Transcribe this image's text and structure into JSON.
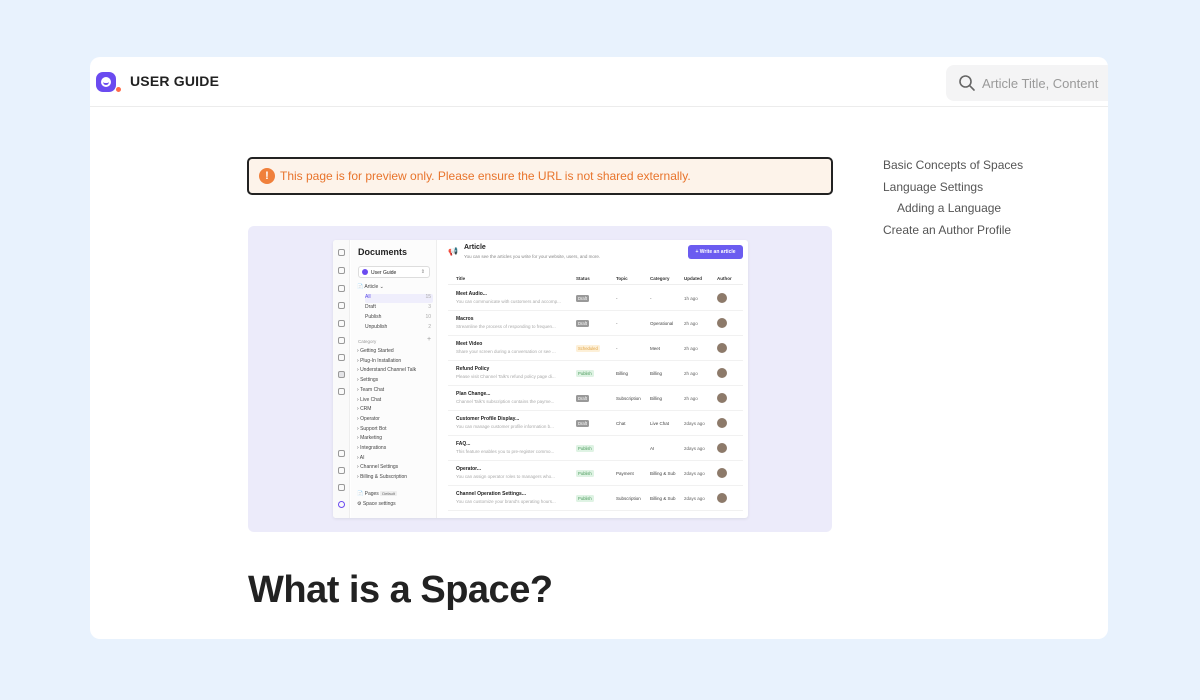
{
  "header": {
    "brand": "USER GUIDE",
    "search_placeholder": "Article Title, Content"
  },
  "notice": {
    "icon": "!",
    "text": "This page is for preview only. Please ensure the URL is not shared externally."
  },
  "toc": [
    {
      "label": "Basic Concepts of Spaces"
    },
    {
      "label": "Language Settings"
    },
    {
      "label": "Adding a Language"
    },
    {
      "label": "Create an Author Profile"
    }
  ],
  "heading": "What is a Space?",
  "preview": {
    "docs_title": "Documents",
    "space_name": "User Guide",
    "article_root": "Article",
    "status_items": [
      {
        "label": "All",
        "count": "15"
      },
      {
        "label": "Draft",
        "count": "3"
      },
      {
        "label": "Publish",
        "count": "10"
      },
      {
        "label": "Unpublish",
        "count": "2"
      }
    ],
    "category_label": "Category",
    "category_items": [
      "Getting Started",
      "Plug-In Installation",
      "Understand Channel Talk",
      "Settings",
      "Team Chat",
      "Live Chat",
      "CRM",
      "Operator",
      "Support Bot",
      "Marketing",
      "Integrations",
      "AI",
      "Channel Settings",
      "Billing & Subscription"
    ],
    "pages_label": "Pages",
    "pages_badge": "Default",
    "space_settings_label": "Space settings",
    "article_title": "Article",
    "article_sub": "You can see the articles you write for your website, users, and more.",
    "write_button": "+ Write an article",
    "columns": [
      "Title",
      "Status",
      "Topic",
      "Category",
      "Updated",
      "Author"
    ],
    "rows": [
      {
        "title": "Meet Audio...",
        "desc": "You can communicate with customers and accomp...",
        "status": "Draft",
        "status_type": "draft",
        "topic": "-",
        "category": "-",
        "updated": "1h ago"
      },
      {
        "title": "Macros",
        "desc": "Streamline the process of responding to frequen...",
        "status": "Draft",
        "status_type": "draft",
        "topic": "-",
        "category": "Operational",
        "updated": "2h ago"
      },
      {
        "title": "Meet Video",
        "desc": "Share your screen during a conversation or see ...",
        "status": "Scheduled",
        "status_type": "sched",
        "topic": "-",
        "category": "Meet",
        "updated": "2h ago"
      },
      {
        "title": "Refund Policy",
        "desc": "Please visit Channel Talk's refund policy page di...",
        "status": "Publish",
        "status_type": "pub",
        "topic": "Billing",
        "category": "Billing",
        "updated": "2h ago"
      },
      {
        "title": "Plan Change...",
        "desc": "Channel Talk's subscription contains the payme...",
        "status": "Draft",
        "status_type": "draft",
        "topic": "Subscription",
        "category": "Billing",
        "updated": "2h ago"
      },
      {
        "title": "Customer Profile Display...",
        "desc": "You can manage customer profile information b...",
        "status": "Draft",
        "status_type": "draft",
        "topic": "Chat",
        "category": "Live Chat",
        "updated": "2days ago"
      },
      {
        "title": "FAQ...",
        "desc": "This feature enables you to pre-register commo...",
        "status": "Publish",
        "status_type": "pub",
        "topic": "",
        "category": "AI",
        "updated": "2days ago"
      },
      {
        "title": "Operator...",
        "desc": "You can assign operator roles to managers who...",
        "status": "Publish",
        "status_type": "pub",
        "topic": "Payment",
        "category": "Billing & Sub",
        "updated": "2days ago"
      },
      {
        "title": "Channel Operation Settings...",
        "desc": "You can customize your brand's operating hours...",
        "status": "Publish",
        "status_type": "pub",
        "topic": "Subscription",
        "category": "Billing & Sub",
        "updated": "2days ago"
      }
    ],
    "colors": {
      "accent": "#6b5cf0",
      "bg": "#ecebfa"
    }
  }
}
